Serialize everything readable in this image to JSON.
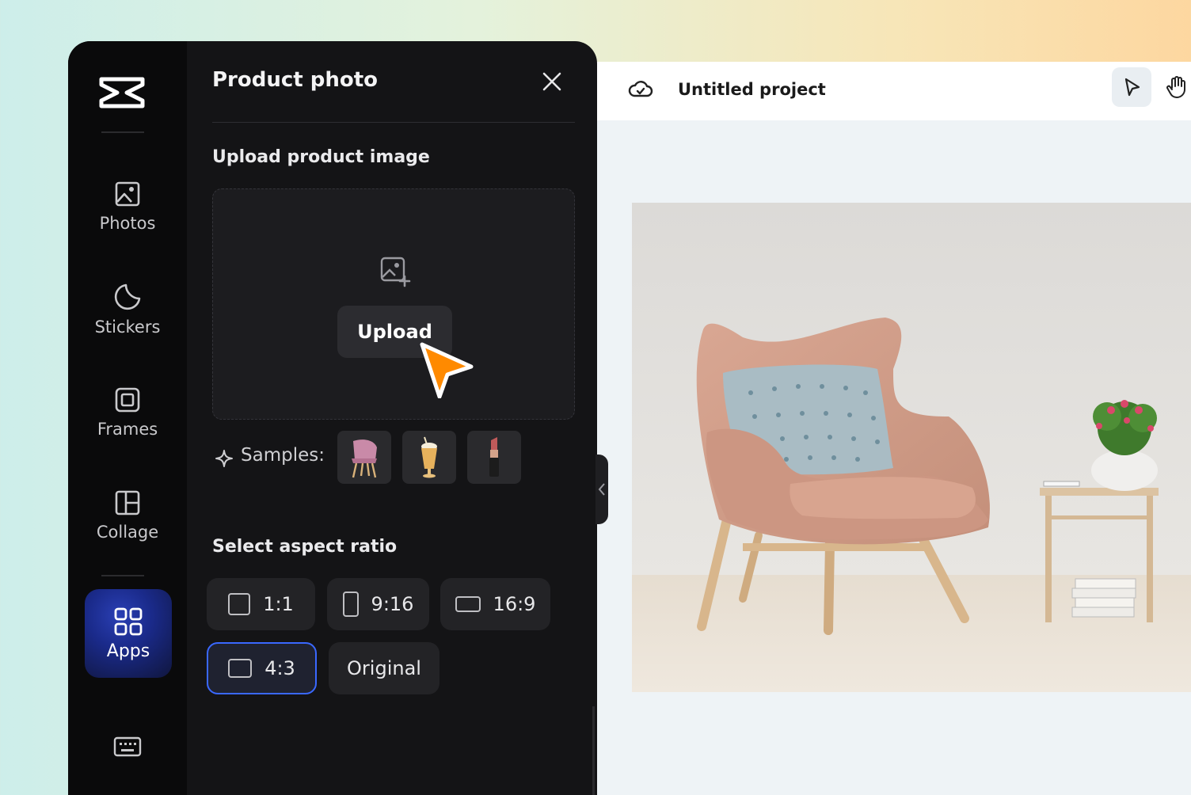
{
  "header": {
    "project_title": "Untitled project",
    "tools": [
      "pointer-tool",
      "hand-tool"
    ]
  },
  "sidebar": {
    "items": [
      {
        "label": "Photos",
        "icon": "image-icon"
      },
      {
        "label": "Stickers",
        "icon": "sticker-icon"
      },
      {
        "label": "Frames",
        "icon": "frame-icon"
      },
      {
        "label": "Collage",
        "icon": "collage-icon"
      },
      {
        "label": "Apps",
        "icon": "apps-grid-icon",
        "active": true
      }
    ]
  },
  "panel": {
    "title": "Product photo",
    "upload_section_label": "Upload product image",
    "upload_button": "Upload",
    "samples_label": "Samples:",
    "samples": [
      "pink-chair",
      "milkshake",
      "lipstick"
    ],
    "aspect_section_label": "Select aspect ratio",
    "aspect_ratios": [
      {
        "label": "1:1",
        "selected": false
      },
      {
        "label": "9:16",
        "selected": false
      },
      {
        "label": "16:9",
        "selected": false
      },
      {
        "label": "4:3",
        "selected": true
      },
      {
        "label": "Original",
        "selected": false
      }
    ]
  },
  "colors": {
    "accent": "#3a68ff",
    "cursor": "#ff8a00",
    "panel_bg": "#141416"
  }
}
